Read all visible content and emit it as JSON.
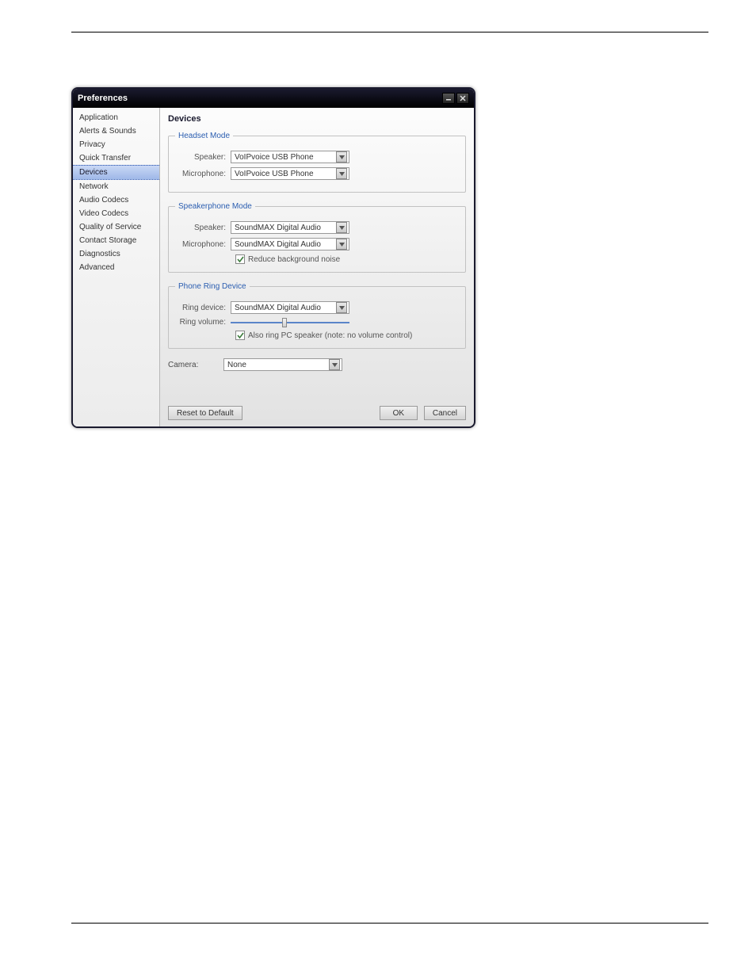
{
  "window": {
    "title": "Preferences"
  },
  "sidebar": {
    "items": [
      "Application",
      "Alerts & Sounds",
      "Privacy",
      "Quick Transfer",
      "Devices",
      "Network",
      "Audio Codecs",
      "Video Codecs",
      "Quality of Service",
      "Contact Storage",
      "Diagnostics",
      "Advanced"
    ],
    "selected_index": 4
  },
  "content": {
    "title": "Devices",
    "headset": {
      "legend": "Headset Mode",
      "speaker_label": "Speaker:",
      "speaker_value": "VoIPvoice USB Phone",
      "mic_label": "Microphone:",
      "mic_value": "VoIPvoice USB Phone"
    },
    "speakerphone": {
      "legend": "Speakerphone Mode",
      "speaker_label": "Speaker:",
      "speaker_value": "SoundMAX Digital Audio",
      "mic_label": "Microphone:",
      "mic_value": "SoundMAX Digital Audio",
      "reduce_noise_label": "Reduce background noise",
      "reduce_noise_checked": true
    },
    "ring": {
      "legend": "Phone Ring Device",
      "device_label": "Ring device:",
      "device_value": "SoundMAX Digital Audio",
      "volume_label": "Ring volume:",
      "volume_percent": 45,
      "also_ring_label": "Also ring PC speaker (note: no volume control)",
      "also_ring_checked": true
    },
    "camera": {
      "label": "Camera:",
      "value": "None"
    }
  },
  "buttons": {
    "reset": "Reset to Default",
    "ok": "OK",
    "cancel": "Cancel"
  }
}
